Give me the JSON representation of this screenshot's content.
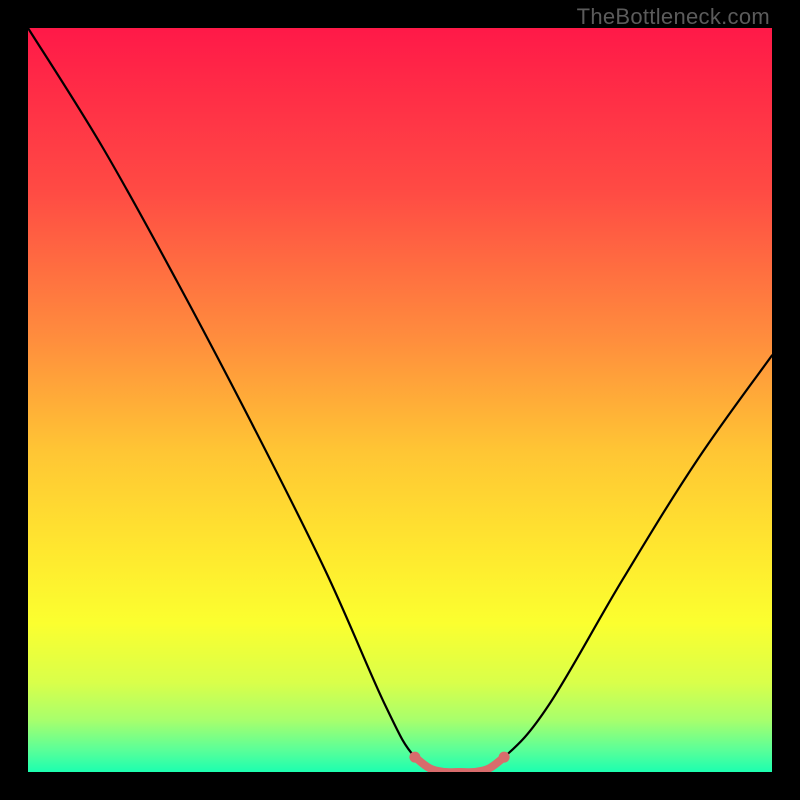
{
  "watermark": "TheBottleneck.com",
  "colors": {
    "frame": "#000000",
    "curve": "#000000",
    "marker": "#d86c6c"
  },
  "chart_data": {
    "type": "line",
    "title": "",
    "xlabel": "",
    "ylabel": "",
    "xlim": [
      0,
      100
    ],
    "ylim": [
      0,
      100
    ],
    "grid": false,
    "legend": false,
    "series": [
      {
        "name": "bottleneck-curve",
        "x": [
          0,
          10,
          20,
          30,
          40,
          48,
          52,
          56,
          60,
          64,
          70,
          80,
          90,
          100
        ],
        "y": [
          100,
          84,
          66,
          47,
          27,
          9,
          2,
          0,
          0,
          2,
          9,
          26,
          42,
          56
        ]
      },
      {
        "name": "optimal-zone",
        "x": [
          52,
          54,
          56,
          58,
          60,
          62,
          64
        ],
        "y": [
          2,
          0.5,
          0,
          0,
          0,
          0.5,
          2
        ]
      }
    ],
    "gradient_stops": [
      {
        "offset": 0.0,
        "color": "#ff1948"
      },
      {
        "offset": 0.22,
        "color": "#ff4b44"
      },
      {
        "offset": 0.42,
        "color": "#ff8e3d"
      },
      {
        "offset": 0.57,
        "color": "#ffc634"
      },
      {
        "offset": 0.7,
        "color": "#ffe72f"
      },
      {
        "offset": 0.8,
        "color": "#fbff2f"
      },
      {
        "offset": 0.88,
        "color": "#d9ff4a"
      },
      {
        "offset": 0.93,
        "color": "#a8ff6c"
      },
      {
        "offset": 0.97,
        "color": "#5bff98"
      },
      {
        "offset": 1.0,
        "color": "#1cffb0"
      }
    ]
  }
}
